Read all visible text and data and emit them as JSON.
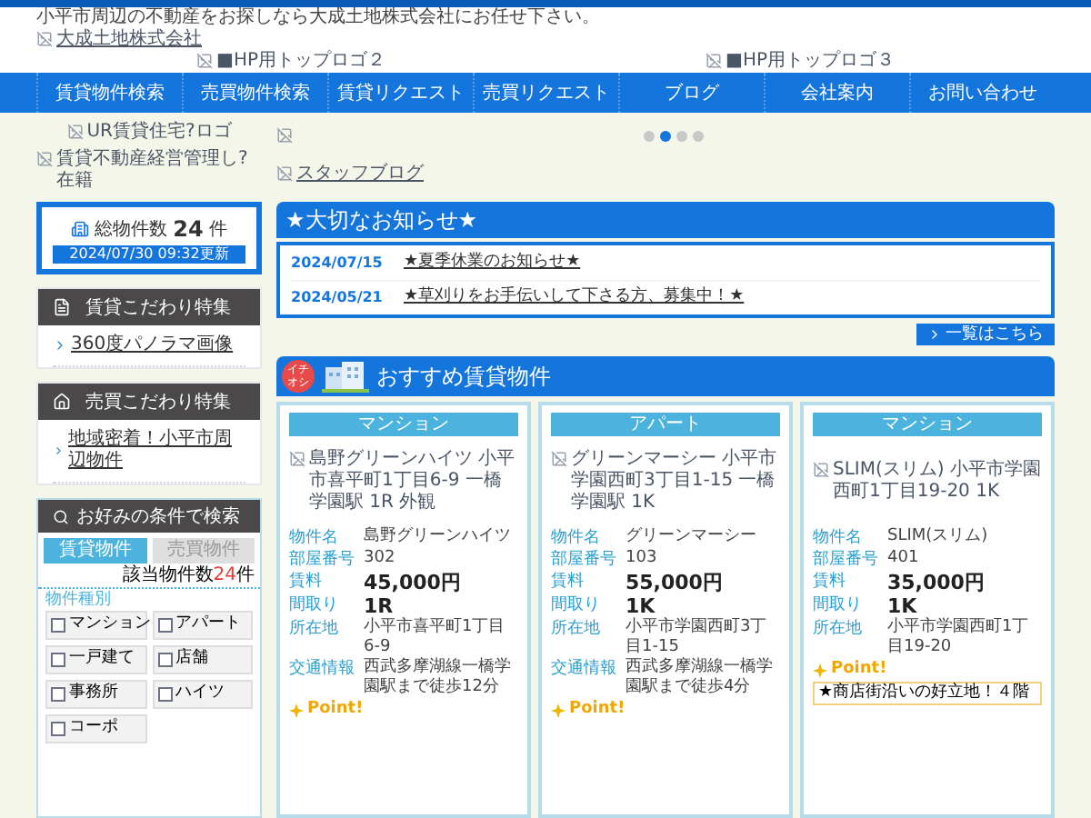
{
  "tagline": "小平市周辺の不動産をお探しなら大成土地株式会社にお任せ下さい。",
  "logo_alt": "大成土地株式会社",
  "header_images": [
    "■HP用トップロゴ２",
    "■HP用トップロゴ３"
  ],
  "nav": [
    "賃貸物件検索",
    "売買物件検索",
    "賃貸リクエスト",
    "売買リクエスト",
    "ブログ",
    "会社案内",
    "お問い合わせ"
  ],
  "side_banners": [
    "UR賃貸住宅?ロゴ",
    "賃貸不動産経営管理し?在籍"
  ],
  "slider": {
    "dots": [
      {
        "selected": false
      },
      {
        "selected": true
      },
      {
        "selected": false
      },
      {
        "selected": false
      }
    ],
    "link": "スタッフブログ"
  },
  "total": {
    "label": "総物件数",
    "count": "24",
    "unit": "件",
    "updated": "2024/07/30 09:32更新"
  },
  "features": [
    {
      "kind": "rent",
      "title": "賃貸こだわり特集",
      "links": [
        "360度パノラマ画像"
      ]
    },
    {
      "kind": "sale",
      "title": "売買こだわり特集",
      "links": [
        "地域密着！小平市周辺物件"
      ]
    }
  ],
  "search": {
    "title": "お好みの条件で検索",
    "tabs": [
      {
        "label": "賃貸物件",
        "selected": true
      },
      {
        "label": "売買物件",
        "selected": false
      }
    ],
    "count": {
      "prefix": "該当物件数",
      "value": "24",
      "suffix": "件"
    },
    "group": "物件種別",
    "options": [
      {
        "label": "マンション",
        "checked": false
      },
      {
        "label": "アパート",
        "checked": false
      },
      {
        "label": "一戸建て",
        "checked": false
      },
      {
        "label": "店舗",
        "checked": false
      },
      {
        "label": "事務所",
        "checked": false
      },
      {
        "label": "ハイツ",
        "checked": false
      },
      {
        "label": "コーポ",
        "checked": false
      }
    ]
  },
  "news": {
    "title": "★大切なお知らせ★",
    "items": [
      {
        "date": "2024/07/15",
        "text": "★夏季休業のお知らせ★"
      },
      {
        "date": "2024/05/21",
        "text": "★草刈りをお手伝いして下さる方、募集中！★"
      }
    ],
    "more": "一覧はこちら"
  },
  "recommended": {
    "badge": "イチオシ",
    "title": "おすすめ賃貸物件",
    "cards": [
      {
        "type": "マンション",
        "image_alt": "島野グリーンハイツ 小平市喜平町1丁目6-9 一橋学園駅 1R 外観",
        "fields": [
          {
            "kind": "plain",
            "label": "物件名",
            "value": "島野グリーンハイツ"
          },
          {
            "kind": "plain",
            "label": "部屋番号",
            "value": "302"
          },
          {
            "kind": "big",
            "label": "賃料",
            "value": "45,000円"
          },
          {
            "kind": "big",
            "label": "間取り",
            "value": "1R"
          },
          {
            "kind": "plain",
            "label": "所在地",
            "value": "小平市喜平町1丁目6-9"
          },
          {
            "kind": "plain",
            "label": "交通情報",
            "value": "西武多摩湖線一橋学園駅まで徒歩12分"
          }
        ],
        "point": "Point!"
      },
      {
        "type": "アパート",
        "image_alt": "グリーンマーシー 小平市学園西町3丁目1-15 一橋学園駅 1K",
        "fields": [
          {
            "kind": "plain",
            "label": "物件名",
            "value": "グリーンマーシー"
          },
          {
            "kind": "plain",
            "label": "部屋番号",
            "value": "103"
          },
          {
            "kind": "big",
            "label": "賃料",
            "value": "55,000円"
          },
          {
            "kind": "big",
            "label": "間取り",
            "value": "1K"
          },
          {
            "kind": "plain",
            "label": "所在地",
            "value": "小平市学園西町3丁目1-15"
          },
          {
            "kind": "plain",
            "label": "交通情報",
            "value": "西武多摩湖線一橋学園駅まで徒歩4分"
          }
        ],
        "point": "Point!"
      },
      {
        "type": "マンション",
        "image_alt": "SLIM(スリム) 小平市学園西町1丁目19-20 1K",
        "fields": [
          {
            "kind": "plain",
            "label": "物件名",
            "value": "SLIM(スリム)"
          },
          {
            "kind": "plain",
            "label": "部屋番号",
            "value": "401"
          },
          {
            "kind": "big",
            "label": "賃料",
            "value": "35,000円"
          },
          {
            "kind": "big",
            "label": "間取り",
            "value": "1K"
          },
          {
            "kind": "plain",
            "label": "所在地",
            "value": "小平市学園西町1丁目19-20"
          }
        ],
        "point": "Point!",
        "note": "★商店街沿いの好立地！４階"
      }
    ]
  }
}
